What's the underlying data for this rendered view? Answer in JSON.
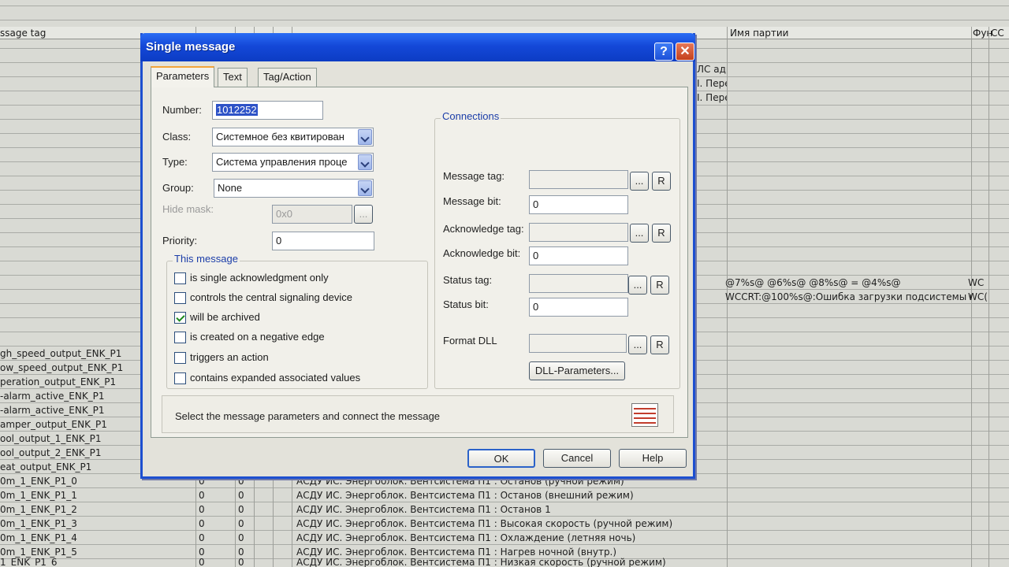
{
  "background_table": {
    "header": {
      "col1": "ssage tag",
      "col_partial": "ЛС адр",
      "party": "Имя партии",
      "fun": "Фун",
      "mini": "СС"
    },
    "right_rows": [
      {
        "col_a": "I. Пере"
      },
      {
        "col_a": "I. Пере"
      }
    ],
    "right_text_rows": [
      {
        "text": "@7%s@ @6%s@   @8%s@ = @4%s@",
        "fun": "WC"
      },
      {
        "text": "WCCRT:@100%s@:Ошибка загрузки подсистемы СWC",
        "fun": "WC("
      }
    ],
    "left_tags": [
      "gh_speed_output_ENK_P1",
      "ow_speed_output_ENK_P1",
      "peration_output_ENK_P1",
      "-alarm_active_ENK_P1",
      "-alarm_active_ENK_P1",
      "amper_output_ENK_P1",
      "ool_output_1_ENK_P1",
      "ool_output_2_ENK_P1",
      "eat_output_ENK_P1"
    ],
    "bottom_rows": [
      {
        "tag": "0m_1_ENK_P1_0",
        "v1": "0",
        "v2": "0",
        "text": "АСДУ ИС. Энергоблок. Вентсистема П1 : Останов (ручной режим)"
      },
      {
        "tag": "0m_1_ENK_P1_1",
        "v1": "0",
        "v2": "0",
        "text": "АСДУ ИС. Энергоблок. Вентсистема П1 : Останов (внешний режим)"
      },
      {
        "tag": "0m_1_ENK_P1_2",
        "v1": "0",
        "v2": "0",
        "text": "АСДУ ИС. Энергоблок. Вентсистема П1 : Останов 1"
      },
      {
        "tag": "0m_1_ENK_P1_3",
        "v1": "0",
        "v2": "0",
        "text": "АСДУ ИС. Энергоблок. Вентсистема П1 : Высокая скорость (ручной режим)"
      },
      {
        "tag": "0m_1_ENK_P1_4",
        "v1": "0",
        "v2": "0",
        "text": "АСДУ ИС. Энергоблок. Вентсистема П1 : Охлаждение (летняя ночь)"
      },
      {
        "tag": "0m_1_ENK_P1_5",
        "v1": "0",
        "v2": "0",
        "text": "АСДУ ИС. Энергоблок. Вентсистема П1 : Нагрев ночной (внутр.)"
      },
      {
        "tag": "1_ENK_P1_6",
        "v1": "0",
        "v2": "0",
        "text": "АСДУ ИС. Энергоблок. Вентсистема П1 : Низкая скорость (ручной режим)"
      }
    ]
  },
  "dialog": {
    "title": "Single message",
    "help_glyph": "?",
    "close_glyph": "✕",
    "tabs": [
      "Parameters",
      "Text",
      "Tag/Action"
    ],
    "active_tab": "Parameters",
    "number_label": "Number:",
    "number_value": "1012252",
    "class_label": "Class:",
    "class_value": "Системное без квитирован",
    "type_label": "Type:",
    "type_value": "Система управления проце",
    "group_label": "Group:",
    "group_value": "None",
    "hide_mask_label": "Hide mask:",
    "hide_mask_value": "0x0",
    "hide_mask_button": "...",
    "priority_label": "Priority:",
    "priority_value": "0",
    "this_message": {
      "title": "This message",
      "options": [
        {
          "label": "is single acknowledgment only",
          "checked": false
        },
        {
          "label": "controls the central signaling device",
          "checked": false
        },
        {
          "label": "will be archived",
          "checked": true
        },
        {
          "label": "is created on a negative edge",
          "checked": false
        },
        {
          "label": "triggers an action",
          "checked": false
        },
        {
          "label": "contains expanded associated values",
          "checked": false
        }
      ]
    },
    "connections": {
      "title": "Connections",
      "message_tag_label": "Message tag:",
      "message_tag_value": "",
      "message_bit_label": "Message bit:",
      "message_bit_value": "0",
      "ack_tag_label": "Acknowledge tag:",
      "ack_tag_value": "",
      "ack_bit_label": "Acknowledge bit:",
      "ack_bit_value": "0",
      "status_tag_label": "Status tag:",
      "status_tag_value": "",
      "status_bit_label": "Status bit:",
      "status_bit_value": "0",
      "format_dll_label": "Format DLL",
      "format_dll_value": "",
      "browse_label": "...",
      "r_label": "R",
      "dll_params_label": "DLL-Parameters..."
    },
    "status_text": "Select the message parameters and connect the message",
    "ok_label": "OK",
    "cancel_label": "Cancel",
    "help_label": "Help"
  }
}
